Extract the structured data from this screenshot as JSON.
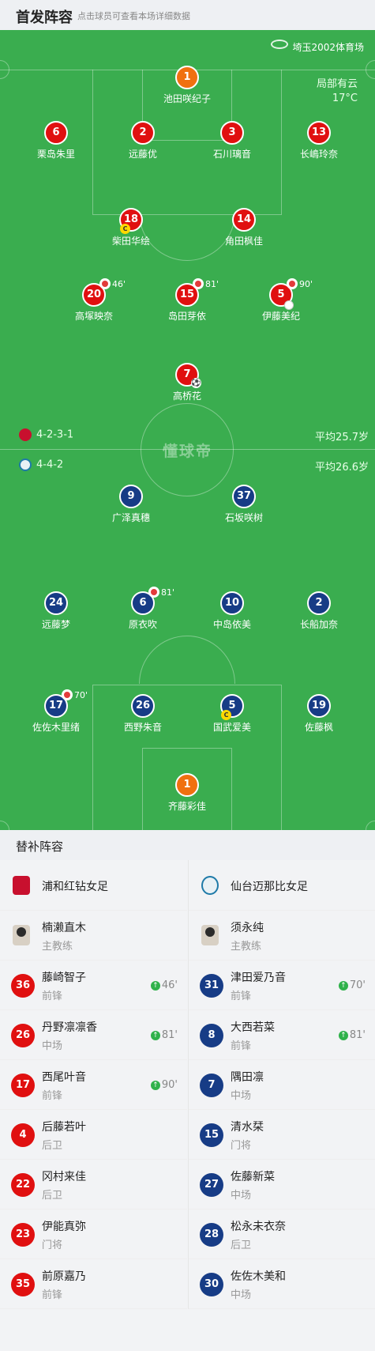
{
  "header": {
    "title": "首发阵容",
    "subtitle": "点击球员可查看本场详细数据"
  },
  "match": {
    "venue": "埼玉2002体育场",
    "weather": "局部有云",
    "temperature": "17°C"
  },
  "watermark": "懂球帝",
  "home": {
    "formation": "4-2-3-1",
    "avg_age": "平均25.7岁",
    "color": "#e01010",
    "players": {
      "gk": {
        "num": "1",
        "name": "池田咲纪子"
      },
      "d1": {
        "num": "6",
        "name": "栗岛朱里"
      },
      "d2": {
        "num": "2",
        "name": "远藤优"
      },
      "d3": {
        "num": "3",
        "name": "石川璃音"
      },
      "d4": {
        "num": "13",
        "name": "长嶋玲奈"
      },
      "m1": {
        "num": "18",
        "name": "柴田华绘"
      },
      "m2": {
        "num": "14",
        "name": "角田枫佳"
      },
      "a1": {
        "num": "20",
        "name": "高塚映奈",
        "sub": "46'"
      },
      "a2": {
        "num": "15",
        "name": "岛田芽依",
        "sub": "81'"
      },
      "a3": {
        "num": "5",
        "name": "伊藤美纪",
        "sub": "90'"
      },
      "st": {
        "num": "7",
        "name": "高桥花"
      }
    }
  },
  "away": {
    "formation": "4-4-2",
    "avg_age": "平均26.6岁",
    "color": "#173c86",
    "players": {
      "f1": {
        "num": "9",
        "name": "广泽真穗"
      },
      "f2": {
        "num": "37",
        "name": "石坂咲树"
      },
      "m1": {
        "num": "24",
        "name": "远藤梦"
      },
      "m2": {
        "num": "6",
        "name": "原衣吹",
        "sub": "81'"
      },
      "m3": {
        "num": "10",
        "name": "中岛依美"
      },
      "m4": {
        "num": "2",
        "name": "长船加奈"
      },
      "d1": {
        "num": "17",
        "name": "佐佐木里绪",
        "sub": "70'"
      },
      "d2": {
        "num": "26",
        "name": "西野朱音"
      },
      "d3": {
        "num": "5",
        "name": "国武爱美"
      },
      "d4": {
        "num": "19",
        "name": "佐藤枫"
      },
      "gk": {
        "num": "1",
        "name": "齐藤彩佳"
      }
    }
  },
  "subs": {
    "title": "替补阵容",
    "home": {
      "team": "浦和红钻女足",
      "coach": {
        "name": "楠濑直木",
        "role": "主教练"
      },
      "list": [
        {
          "num": "36",
          "name": "藤崎智子",
          "pos": "前锋",
          "time": "46'"
        },
        {
          "num": "26",
          "name": "丹野凛凛香",
          "pos": "中场",
          "time": "81'"
        },
        {
          "num": "17",
          "name": "西尾叶音",
          "pos": "前锋",
          "time": "90'"
        },
        {
          "num": "4",
          "name": "后藤若叶",
          "pos": "后卫",
          "time": ""
        },
        {
          "num": "22",
          "name": "冈村来佳",
          "pos": "后卫",
          "time": ""
        },
        {
          "num": "23",
          "name": "伊能真弥",
          "pos": "门将",
          "time": ""
        },
        {
          "num": "35",
          "name": "前原嘉乃",
          "pos": "前锋",
          "time": ""
        }
      ]
    },
    "away": {
      "team": "仙台迈那比女足",
      "coach": {
        "name": "须永纯",
        "role": "主教练"
      },
      "list": [
        {
          "num": "31",
          "name": "津田爱乃音",
          "pos": "前锋",
          "time": "70'"
        },
        {
          "num": "8",
          "name": "大西若菜",
          "pos": "前锋",
          "time": "81'"
        },
        {
          "num": "7",
          "name": "隅田凛",
          "pos": "中场",
          "time": ""
        },
        {
          "num": "15",
          "name": "清水栞",
          "pos": "门将",
          "time": ""
        },
        {
          "num": "27",
          "name": "佐藤新菜",
          "pos": "中场",
          "time": ""
        },
        {
          "num": "28",
          "name": "松永未衣奈",
          "pos": "后卫",
          "time": ""
        },
        {
          "num": "30",
          "name": "佐佐木美和",
          "pos": "中场",
          "time": ""
        }
      ]
    }
  }
}
